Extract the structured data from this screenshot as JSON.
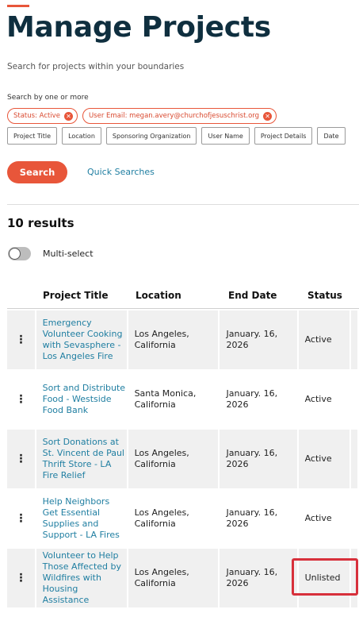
{
  "header": {
    "title": "Manage Projects",
    "subtitle": "Search for projects within your boundaries"
  },
  "filters": {
    "search_by_label": "Search by one or more",
    "active_chips": [
      {
        "label": "Status: Active"
      },
      {
        "label": "User Email: megan.avery@churchofjesuschrist.org"
      }
    ],
    "options": [
      "Project Title",
      "Location",
      "Sponsoring Organization",
      "User Name",
      "Project Details",
      "Date"
    ]
  },
  "actions": {
    "search_label": "Search",
    "quick_searches_label": "Quick Searches"
  },
  "results": {
    "count_label": "10 results",
    "multiselect_label": "Multi-select",
    "multiselect_on": false
  },
  "table": {
    "columns": [
      "Project Title",
      "Location",
      "End Date",
      "Status"
    ],
    "menu_glyph": "⋮",
    "rows": [
      {
        "title": "Emergency Volunteer Cooking with Sevasphere - Los Angeles Fire",
        "location": "Los Angeles, California",
        "end_date": "January. 16, 2026",
        "status": "Active"
      },
      {
        "title": "Sort and Distribute Food - Westside Food Bank",
        "location": "Santa Monica, California",
        "end_date": "January. 16, 2026",
        "status": "Active"
      },
      {
        "title": "Sort Donations at St. Vincent de Paul Thrift Store - LA Fire Relief",
        "location": "Los Angeles, California",
        "end_date": "January. 16, 2026",
        "status": "Active"
      },
      {
        "title": "Help Neighbors Get Essential Supplies and Support - LA Fires",
        "location": "Los Angeles, California",
        "end_date": "January. 16, 2026",
        "status": "Active"
      },
      {
        "title": "Volunteer to Help Those Affected by Wildfires with Housing Assistance",
        "location": "Los Angeles, California",
        "end_date": "January. 16, 2026",
        "status": "Unlisted"
      }
    ]
  },
  "colors": {
    "accent": "#e8563a",
    "title": "#0f2f3f",
    "link": "#1f7ea1",
    "highlight": "#d7303b"
  }
}
